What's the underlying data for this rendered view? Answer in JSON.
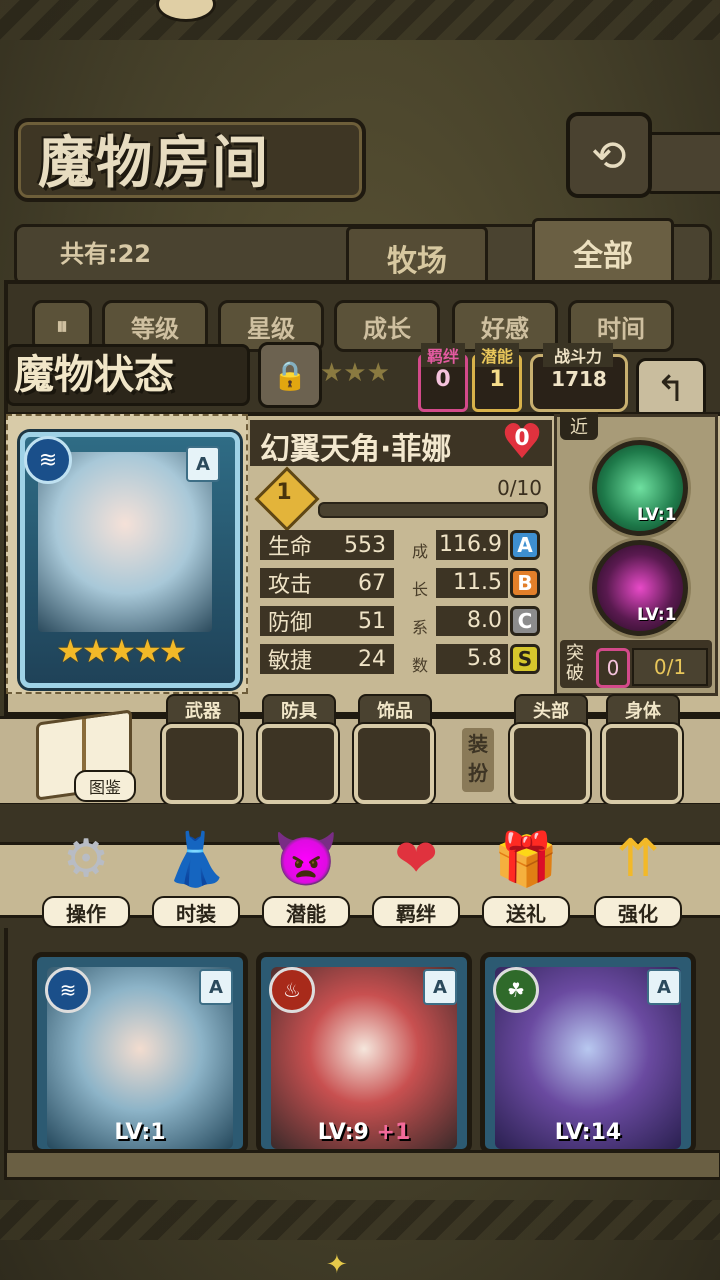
{
  "screen_title": "魔物房间",
  "header": {
    "back_icon": "return-arrow-icon"
  },
  "tabs": {
    "count_label": "共有:22",
    "items": [
      {
        "label": "牧场"
      },
      {
        "label": "全部",
        "active": true
      }
    ]
  },
  "sort": {
    "toggle_icon": "sort-toggle-icon",
    "buttons": [
      {
        "label": "等级"
      },
      {
        "label": "星级"
      },
      {
        "label": "成长"
      },
      {
        "label": "好感"
      },
      {
        "label": "时间"
      }
    ]
  },
  "status": {
    "title": "魔物状态",
    "bond_label": "羁绊",
    "bond_value": "0",
    "potential_label": "潜能",
    "potential_value": "1",
    "power_label": "战斗力",
    "power_value": "1718"
  },
  "monster": {
    "name": "幻翼天角·菲娜",
    "affection": "0",
    "rank": "A",
    "stars": 5,
    "element_icon": "water-element-icon",
    "level": "1",
    "xp": "0/10",
    "stats": [
      {
        "label": "生命",
        "value": "553",
        "growth": "116.9",
        "grade": "A",
        "color": "#3e8fd0"
      },
      {
        "label": "攻击",
        "value": "67",
        "growth": "11.5",
        "grade": "B",
        "color": "#e27f2a"
      },
      {
        "label": "防御",
        "value": "51",
        "growth": "8.0",
        "grade": "C",
        "color": "#8c8c8c"
      },
      {
        "label": "敏捷",
        "value": "24",
        "growth": "5.8",
        "grade": "S",
        "color": "#d6c72c"
      }
    ],
    "growth_vertical": [
      "成",
      "长",
      "系",
      "数"
    ],
    "attack_type": "近",
    "skills": [
      {
        "icon": "tree-skill-icon",
        "level": "LV:1"
      },
      {
        "icon": "sparkle-heal-skill-icon",
        "level": "LV:1"
      }
    ],
    "breakthrough_label": "突破",
    "breakthrough_count": "0",
    "breakthrough_progress": "0/1"
  },
  "equipment": {
    "book_label": "图鉴",
    "slots": [
      {
        "label": "武器"
      },
      {
        "label": "防具"
      },
      {
        "label": "饰品"
      }
    ],
    "decorate_label": "装扮",
    "costume_slots": [
      {
        "label": "头部"
      },
      {
        "label": "身体"
      }
    ]
  },
  "actions": [
    {
      "label": "操作",
      "icon": "gear-icon"
    },
    {
      "label": "时装",
      "icon": "outfit-icon"
    },
    {
      "label": "潜能",
      "icon": "shadow-demon-icon"
    },
    {
      "label": "羁绊",
      "icon": "hearts-icon"
    },
    {
      "label": "送礼",
      "icon": "gift-icon"
    },
    {
      "label": "强化",
      "icon": "upgrade-arrows-icon"
    }
  ],
  "cards": [
    {
      "level": "LV:1",
      "rank": "A",
      "element_icon": "water-element-icon",
      "element_color": "#1a4f8a"
    },
    {
      "level": "LV:9",
      "bonus": "+1",
      "rank": "A",
      "element_icon": "fire-element-icon",
      "element_color": "#a82a1a"
    },
    {
      "level": "LV:14",
      "rank": "A",
      "element_icon": "leaf-element-icon",
      "element_color": "#2f6a2a"
    }
  ]
}
